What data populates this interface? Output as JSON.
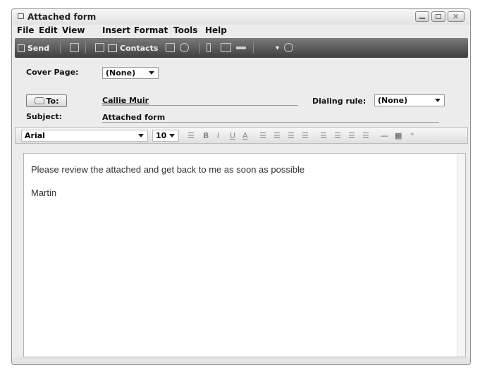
{
  "window": {
    "title": "Attached form"
  },
  "menu": [
    "File",
    "Edit",
    "View",
    "Insert",
    "Format",
    "Tools",
    "Help"
  ],
  "toolbar": {
    "send_label": "Send",
    "contacts_label": "Contacts",
    "icons": [
      "send-icon",
      "attach-icon",
      "address-book-icon",
      "contacts-icon",
      "insert-icon",
      "cover-page-icon",
      "scan-icon",
      "image-icon",
      "line-icon",
      "help-icon"
    ]
  },
  "header": {
    "cover_page_label": "Cover Page:",
    "cover_page_value": "(None)",
    "to_button_label": "To:",
    "to_value": "Callie Muir",
    "dialing_rule_label": "Dialing rule:",
    "dialing_rule_value": "(None)",
    "subject_label": "Subject:",
    "subject_value": "Attached form"
  },
  "format": {
    "font": "Arial",
    "size": "10",
    "tools": [
      "B",
      "I",
      "U",
      "A"
    ]
  },
  "body": {
    "line1": "Please review the attached and get back to me as soon as possible",
    "line2": "Martin"
  }
}
